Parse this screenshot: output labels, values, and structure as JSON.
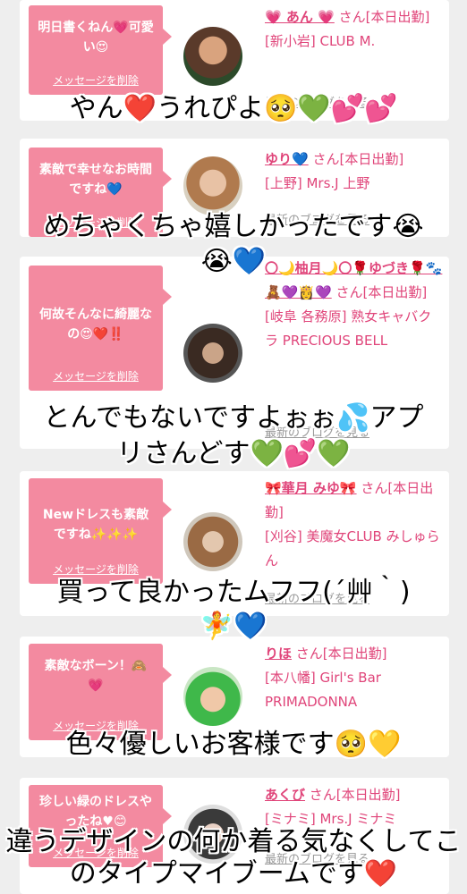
{
  "cards": [
    {
      "message": "明日書くねん💗可愛い😍",
      "delete_label": "メッセージを削除",
      "name": "💗 あん 💗",
      "san": "さん[本日出勤]",
      "line2": "[新小岩] CLUB M.",
      "latest_label": "最新のブログを見る"
    },
    {
      "message": "素敵で幸せなお時間ですね💙",
      "delete_label": "メッセージを削除",
      "name": "ゆり💙",
      "san": "さん[本日出勤]",
      "line2": "[上野] Mrs.J 上野",
      "latest_label": "最新のブログを見る"
    },
    {
      "message": "何故そんなに綺麗なの😍❤️‼️",
      "delete_label": "メッセージを削除",
      "name": "〇🌙柚月🌙〇🌹ゆづき🌹🐾🧸💜👸💜",
      "san": "さん[本日出勤]",
      "line2": "[岐阜 各務原] 熟女キャバクラ PRECIOUS BELL",
      "latest_label": "最新のブログを見る"
    },
    {
      "message": "Newドレスも素敵ですね✨✨✨",
      "delete_label": "メッセージを削除",
      "name": "🎀華月 みゆ🎀",
      "san": "さん[本日出勤]",
      "line2": "[刈谷] 美魔女CLUB みしゅらん",
      "latest_label": "最新のブログを見る"
    },
    {
      "message": "素敵なボーン！🙈💗",
      "delete_label": "メッセージを削除",
      "name": "りほ",
      "san": "さん[本日出勤]",
      "line2": "[本八幡] Girl's Bar PRIMADONNA",
      "latest_label": ""
    },
    {
      "message": "珍しい緑のドレスやったね♥😊",
      "delete_label": "メッセージを削除",
      "name": "あくび",
      "san": "さん[本日出勤]",
      "line2": "[ミナミ] Mrs.J ミナミ",
      "latest_label": "最新のブログを見る"
    }
  ],
  "overlays": [
    "やん❤️うれぴよ🥺💚💕💕",
    "めちゃくちゃ嬉しかったです😭",
    "😭💙",
    "とんでもないですよぉぉ💦アプ",
    "リさんどす💚💕💚",
    "買って良かったムフフ(´艸｀)",
    "🧚💙",
    "色々優しいお客様です🥺💛",
    "違うデザインの何か着る気なくしてこ",
    "のタイプマイブームです❤️"
  ],
  "colors": {
    "bubble": "#f38aa0",
    "link": "#e0457a",
    "background": "#eeeeee"
  }
}
